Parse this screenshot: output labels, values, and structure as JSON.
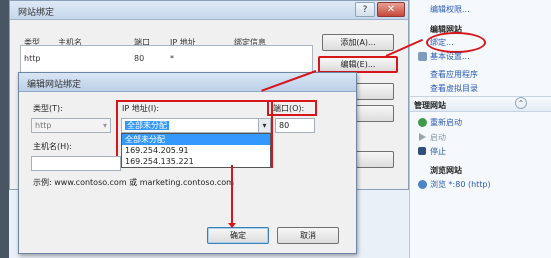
{
  "colors": {
    "highlight": "#d6161b",
    "selection": "#3399ff",
    "link": "#2c5bb5"
  },
  "bg_dialog": {
    "title": "网站绑定",
    "help_btn": "?",
    "columns": [
      "类型",
      "主机名",
      "端口",
      "IP 地址",
      "绑定信息"
    ],
    "row": {
      "type": "http",
      "host": "",
      "port": "80",
      "ip": "*",
      "info": ""
    },
    "add_btn": "添加(A)...",
    "edit_btn": "编辑(E)..."
  },
  "right_panel": {
    "top_link": "编辑权限...",
    "edit_site": {
      "header": "编辑网站",
      "bindings": "绑定...",
      "basic": "基本设置...",
      "view_apps": "查看应用程序",
      "view_vdirs": "查看虚拟目录"
    },
    "manage": {
      "header": "管理网站",
      "restart": "重新启动",
      "start": "启动",
      "stop": "停止"
    },
    "browse": {
      "header": "浏览网站",
      "link": "浏览 *:80 (http)"
    }
  },
  "fg_dialog": {
    "title": "编辑网站绑定",
    "type_label": "类型(T):",
    "type_value": "http",
    "ip_label": "IP 地址(I):",
    "ip_value": "全部未分配",
    "ip_options": [
      "全部未分配",
      "169.254.205.91",
      "169.254.135.221"
    ],
    "port_label": "端口(O):",
    "port_value": "80",
    "host_label": "主机名(H):",
    "example": "示例: www.contoso.com 或 marketing.contoso.com",
    "ok_btn": "确定",
    "cancel_btn": "取消"
  }
}
